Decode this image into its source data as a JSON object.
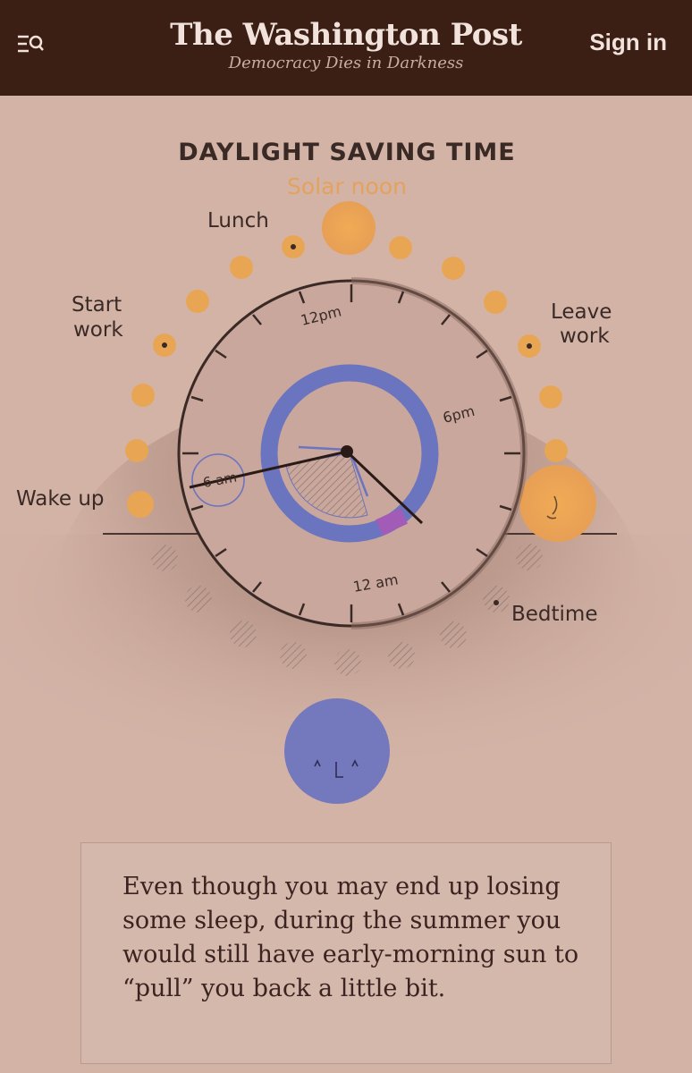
{
  "header": {
    "logo_text": "The Washington Post",
    "tagline": "Democracy Dies in Darkness",
    "sign_in_label": "Sign in",
    "menu_icon": "menu-search-icon",
    "background_color": "#3b1e14"
  },
  "illustration": {
    "title": "DAYLIGHT SAVING TIME",
    "solar_noon_label": "Solar noon",
    "labels": {
      "lunch": "Lunch",
      "start_work_line1": "Start",
      "start_work_line2": "work",
      "leave_work_line1": "Leave",
      "leave_work_line2": "work",
      "wake_up": "Wake up",
      "bedtime": "Bedtime"
    },
    "clock": {
      "label_12pm": "12pm",
      "label_6pm": "6pm",
      "label_6am": "6 am",
      "label_12am": "12 am"
    },
    "colors": {
      "sun": "#e8a655",
      "moon": "#7478bd",
      "sleep_ring": "#6b74be",
      "sleep_shift": "#a35bb8"
    }
  },
  "caption": {
    "text": "Even though you may end up losing some sleep, during the summer you would still have early-morning sun to “pull” you back a little bit."
  }
}
